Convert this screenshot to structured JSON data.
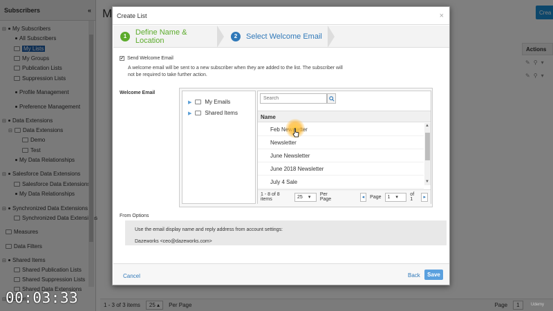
{
  "sidebar": {
    "title": "Subscribers",
    "collapse_icon": "double-chevron-left-icon",
    "items": [
      {
        "label": "My Subscribers",
        "type": "toggle-bullet"
      },
      {
        "label": "All Subscribers",
        "type": "bullet"
      },
      {
        "label": "My Lists",
        "type": "folder",
        "selected": true
      },
      {
        "label": "My Groups",
        "type": "folder"
      },
      {
        "label": "Publication Lists",
        "type": "folder"
      },
      {
        "label": "Suppression Lists",
        "type": "folder"
      },
      {
        "label": "Profile Management",
        "type": "bullet"
      },
      {
        "label": "Preference Management",
        "type": "bullet"
      },
      {
        "label": "Data Extensions",
        "type": "toggle-bullet"
      },
      {
        "label": "Data Extensions",
        "type": "toggle-folder"
      },
      {
        "label": "Demo",
        "type": "folder"
      },
      {
        "label": "Test",
        "type": "folder"
      },
      {
        "label": "My Data Relationships",
        "type": "bullet"
      },
      {
        "label": "Salesforce Data Extensions",
        "type": "toggle-bullet"
      },
      {
        "label": "Salesforce Data Extensions",
        "type": "folder"
      },
      {
        "label": "My Data Relationships",
        "type": "bullet"
      },
      {
        "label": "Synchronized Data Extensions",
        "type": "toggle-bullet"
      },
      {
        "label": "Synchronized Data Extensions",
        "type": "folder"
      },
      {
        "label": "Measures",
        "type": "folder"
      },
      {
        "label": "Data Filters",
        "type": "folder"
      },
      {
        "label": "Shared Items",
        "type": "toggle-bullet"
      },
      {
        "label": "Shared Publication Lists",
        "type": "folder"
      },
      {
        "label": "Shared Suppression Lists",
        "type": "folder"
      },
      {
        "label": "Shared Data Extensions",
        "type": "folder"
      },
      {
        "label": "Exten",
        "type": "toggle-bullet"
      }
    ]
  },
  "main": {
    "title": "My",
    "create_button": "Crea",
    "actions_header": "Actions",
    "footer": {
      "count": "1 - 3 of 3 items",
      "per_page_value": "25",
      "per_page_label": "Per Page",
      "page_label": "Page",
      "page_value": "1"
    }
  },
  "modal": {
    "title": "Create List",
    "close": "×",
    "steps": [
      {
        "num": "1",
        "label": "Define Name & Location"
      },
      {
        "num": "2",
        "label": "Select Welcome Email"
      }
    ],
    "send_welcome": {
      "checked": true,
      "check_mark": "✔",
      "label": "Send Welcome Email",
      "description": "A welcome email will be sent to a new subscriber when they are added to the list. The subscriber will not be required to take further action."
    },
    "welcome_email_label": "Welcome Email",
    "folders": [
      {
        "label": "My Emails"
      },
      {
        "label": "Shared Items"
      }
    ],
    "search": {
      "placeholder": "Search"
    },
    "list_header": "Name",
    "emails": [
      "Feb Newsletter",
      "Newsletter",
      "June Newsletter",
      "June 2018 Newsletter",
      "July 4 Sale"
    ],
    "pager": {
      "count": "1 - 8 of 8 items",
      "per_page_value": "25",
      "per_page_label": "Per Page",
      "page_label": "Page",
      "page_value": "1",
      "of_label": "of 1"
    },
    "from_options": {
      "label": "From Options",
      "line1": "Use the email display name and reply address from account settings:",
      "line2": "Dazeworks <ceo@dazeworks.com>"
    },
    "footer": {
      "cancel": "Cancel",
      "back": "Back",
      "save": "Save"
    }
  },
  "overlay": {
    "timer": "00:03:33",
    "watermark": "Udemy"
  }
}
